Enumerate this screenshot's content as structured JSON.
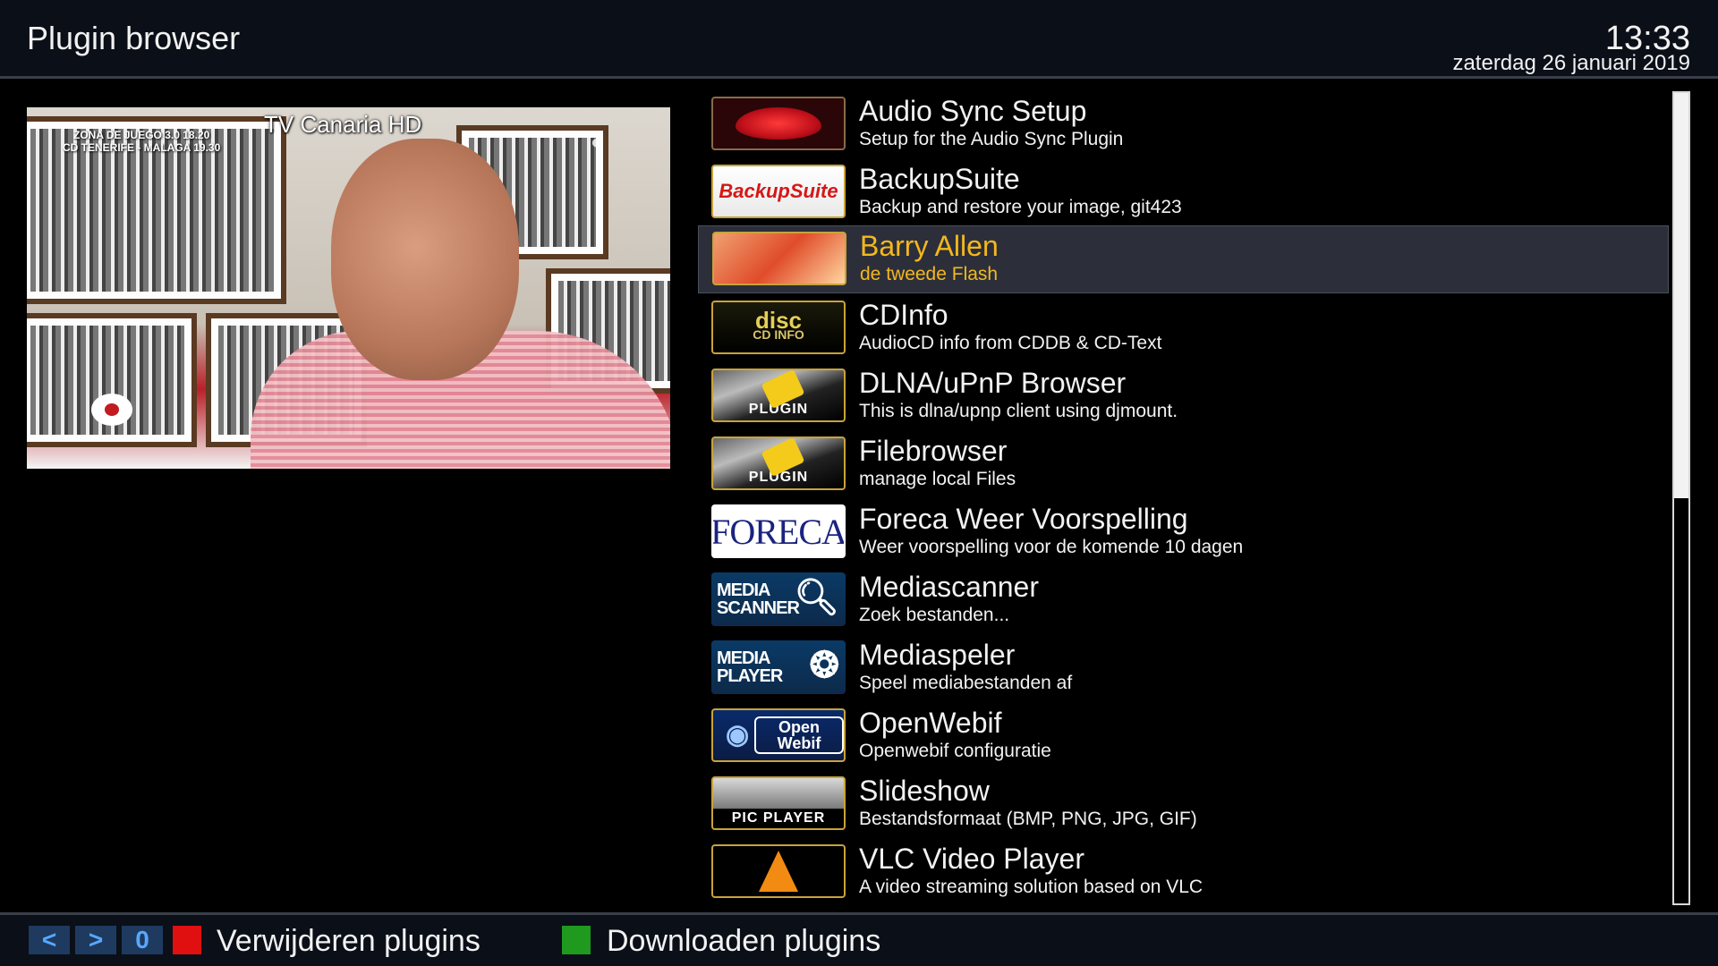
{
  "header": {
    "title": "Plugin browser",
    "time": "13:33",
    "date": "zaterdag 26 januari 2019"
  },
  "preview": {
    "channel": "TV Canaria HD",
    "overlay_line1": "ZONA DE JUEGO 3.0 18.20",
    "overlay_line2": "CD TENERIFE - MALAGA 19.30"
  },
  "plugins": [
    {
      "name": "Audio Sync Setup",
      "description": "Setup for the Audio Sync Plugin",
      "icon": "lips-icon"
    },
    {
      "name": "BackupSuite",
      "description": "Backup and restore your image, git423",
      "icon": "backupsuite-icon",
      "icon_text": "BackupSuite"
    },
    {
      "name": "Barry Allen",
      "description": "de tweede Flash",
      "icon": "flash-icon",
      "selected": true
    },
    {
      "name": "CDInfo",
      "description": "AudioCD info from CDDB & CD-Text",
      "icon": "cd-info-icon",
      "icon_text": "CD INFO",
      "icon_text2": "disc"
    },
    {
      "name": "DLNA/uPnP Browser",
      "description": "This is dlna/upnp client using djmount.",
      "icon": "plugin-icon",
      "icon_text": "PLUGIN"
    },
    {
      "name": "Filebrowser",
      "description": "manage local Files",
      "icon": "plugin-icon",
      "icon_text": "PLUGIN"
    },
    {
      "name": "Foreca Weer Voorspelling",
      "description": "Weer voorspelling voor de komende 10 dagen",
      "icon": "foreca-icon",
      "icon_text": "FORECA"
    },
    {
      "name": "Mediascanner",
      "description": "Zoek bestanden...",
      "icon": "media-scanner-icon",
      "icon_text": "MEDIA SCANNER"
    },
    {
      "name": "Mediaspeler",
      "description": "Speel mediabestanden af",
      "icon": "media-player-icon",
      "icon_text": "MEDIA PLAYER"
    },
    {
      "name": "OpenWebif",
      "description": "Openwebif configuratie",
      "icon": "openwebif-icon",
      "icon_text": "Open Webif"
    },
    {
      "name": "Slideshow",
      "description": "Bestandsformaat (BMP, PNG, JPG, GIF)",
      "icon": "pic-player-icon",
      "icon_text": "PIC PLAYER"
    },
    {
      "name": "VLC Video Player",
      "description": "A video streaming solution based on VLC",
      "icon": "vlc-cone-icon"
    }
  ],
  "scrollbar": {
    "position_fraction": 0.0,
    "visible_fraction": 0.5
  },
  "footer": {
    "key_prev": "<",
    "key_next": ">",
    "key_zero": "0",
    "red_label": "Verwijderen plugins",
    "green_label": "Downloaden plugins"
  },
  "colors": {
    "selected_text": "#f3b81f",
    "red_key": "#e01010",
    "green_key": "#1f9a1f",
    "key_text": "#58a7ff"
  }
}
